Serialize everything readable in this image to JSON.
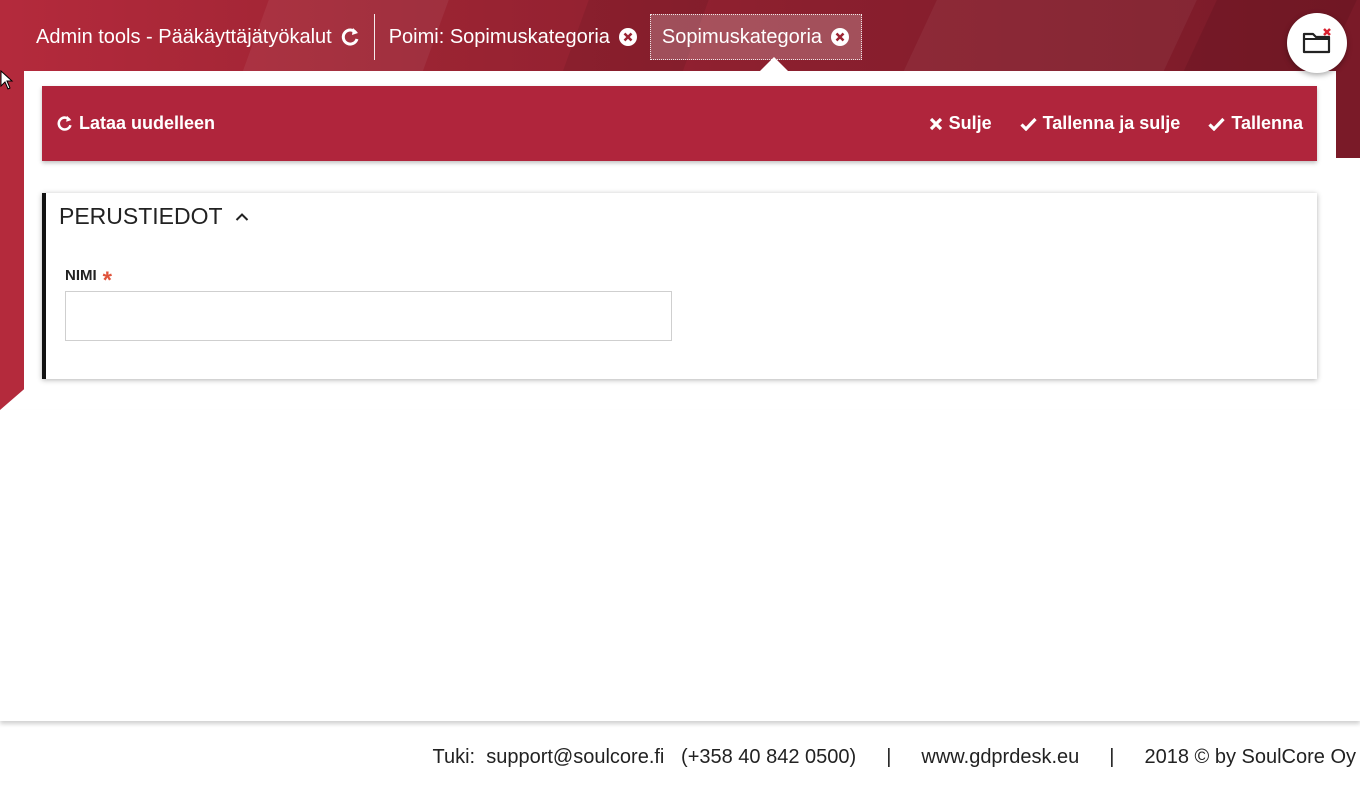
{
  "tabs": [
    {
      "label": "Admin tools - Pääkäyttäjätyökalut",
      "icon": "refresh-icon"
    },
    {
      "label": "Poimi: Sopimuskategoria",
      "icon": "close-circle-icon"
    },
    {
      "label": "Sopimuskategoria",
      "icon": "close-circle-icon",
      "active": true
    }
  ],
  "folder_button": {
    "icon": "folder-icon"
  },
  "toolbar": {
    "reload_label": "Lataa uudelleen",
    "close_label": "Sulje",
    "save_close_label": "Tallenna ja sulje",
    "save_label": "Tallenna"
  },
  "section": {
    "title": "PERUSTIEDOT",
    "fields": [
      {
        "label": "NIMI",
        "required_mark": "*",
        "value": "",
        "placeholder": ""
      }
    ]
  },
  "footer": {
    "support": "Tuki:  support@soulcore.fi   (+358 40 842 0500)",
    "separator": "|",
    "website": "www.gdprdesk.eu",
    "copyright": "2018 © by SoulCore Oy"
  },
  "colors": {
    "brand_red": "#b0253c",
    "required": "#e0533b"
  }
}
